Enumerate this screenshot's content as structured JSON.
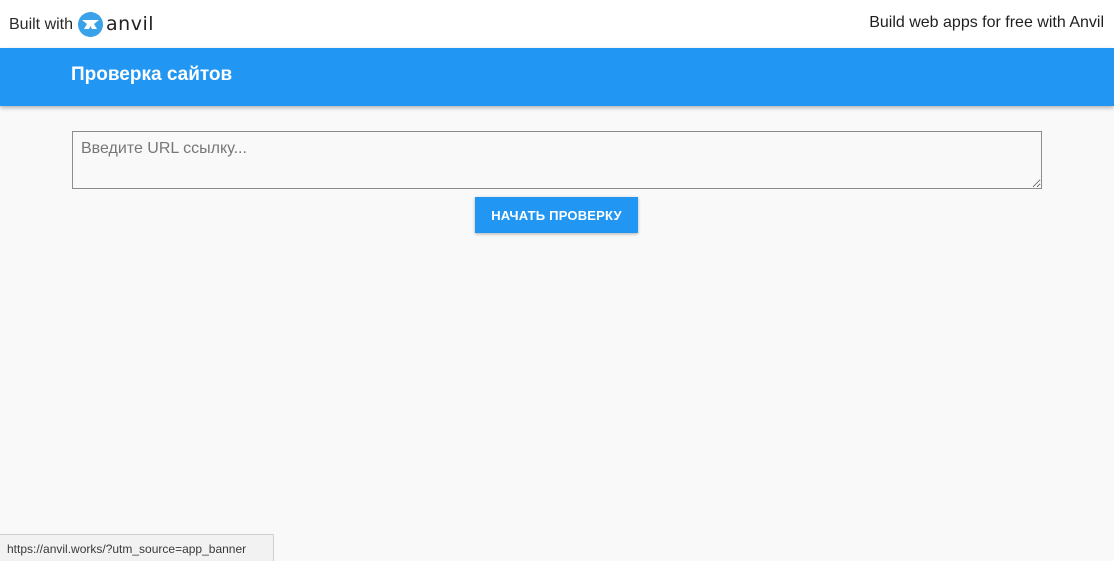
{
  "banner": {
    "built_with_text": "Built with",
    "logo_word": "anvil",
    "logo_icon": "anvil-logo-icon",
    "promo_text": "Build web apps for free with Anvil"
  },
  "app_bar": {
    "title": "Проверка сайтов",
    "color": "#2196f3"
  },
  "url_input": {
    "value": "",
    "placeholder": "Введите URL ссылку..."
  },
  "start_button": {
    "label": "НАЧАТЬ ПРОВЕРКУ"
  },
  "status_bar": {
    "url": "https://anvil.works/?utm_source=app_banner"
  }
}
